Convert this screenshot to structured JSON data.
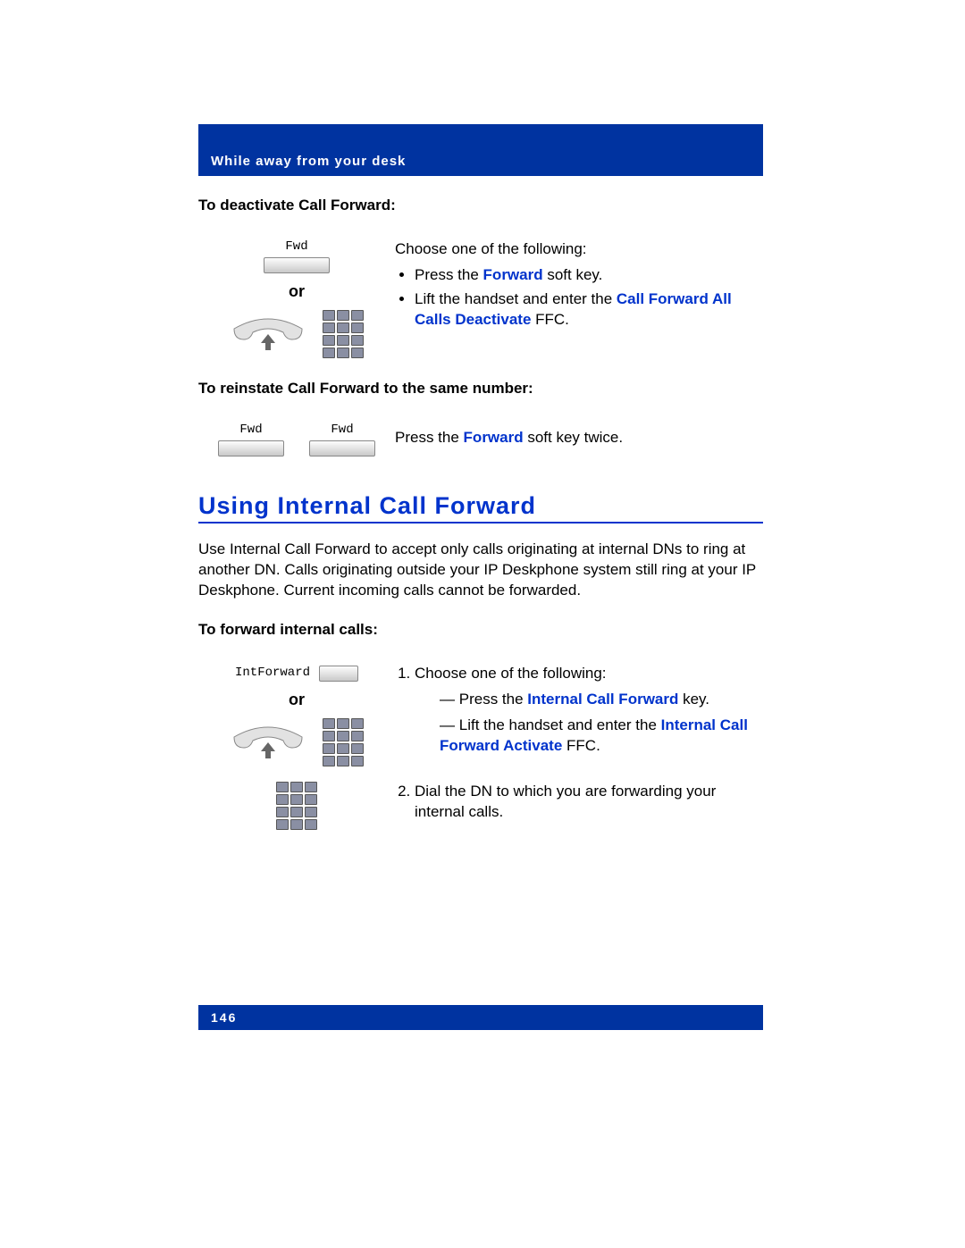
{
  "header": {
    "chapter": "While away from your desk"
  },
  "section1": {
    "title": "To deactivate Call Forward:",
    "fwd_label": "Fwd",
    "or": "or",
    "intro": "Choose one of the following:",
    "b1_pre": "Press the ",
    "b1_em": "Forward",
    "b1_post": " soft key.",
    "b2_pre": "Lift the handset and enter the ",
    "b2_em": "Call Forward All Calls Deactivate",
    "b2_post": " FFC."
  },
  "section2": {
    "title": "To reinstate Call Forward to the same number:",
    "fwd_label": "Fwd",
    "t_pre": "Press the ",
    "t_em": "Forward",
    "t_post": " soft key twice."
  },
  "h2": "Using Internal Call Forward",
  "para": "Use Internal Call Forward to accept only calls originating at internal DNs to ring at another DN. Calls originating outside your IP Deskphone system still ring at your IP Deskphone. Current incoming calls cannot be forwarded.",
  "section3": {
    "title": "To forward internal calls:",
    "int_label": "IntForward",
    "or": "or",
    "li1_intro": "Choose one of the following:",
    "d1_pre": "Press the ",
    "d1_em": "Internal Call Forward",
    "d1_post": " key.",
    "d2_pre": "Lift the handset and enter the ",
    "d2_em": "Internal Call Forward Activate",
    "d2_post": " FFC.",
    "li2": "Dial the DN to which you are forwarding your internal calls."
  },
  "footer": {
    "page": "146"
  }
}
